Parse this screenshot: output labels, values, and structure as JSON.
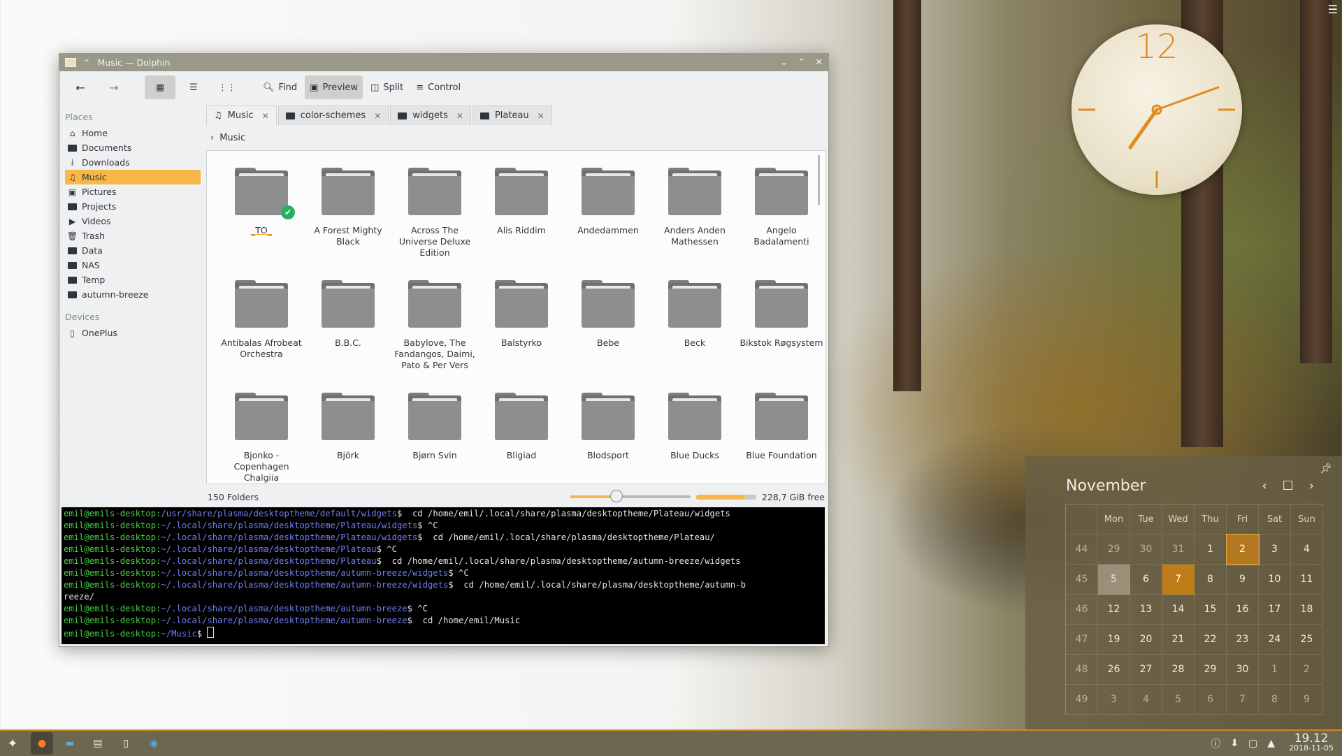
{
  "window": {
    "title": "Music — Dolphin",
    "toolbar": {
      "find": "Find",
      "preview": "Preview",
      "split": "Split",
      "control": "Control"
    },
    "places_heading": "Places",
    "places": [
      {
        "label": "Home",
        "icon": "home-icon"
      },
      {
        "label": "Documents",
        "icon": "documents-icon"
      },
      {
        "label": "Downloads",
        "icon": "download-icon"
      },
      {
        "label": "Music",
        "icon": "music-icon"
      },
      {
        "label": "Pictures",
        "icon": "pictures-icon"
      },
      {
        "label": "Projects",
        "icon": "folder-icon"
      },
      {
        "label": "Videos",
        "icon": "videos-icon"
      },
      {
        "label": "Trash",
        "icon": "trash-icon"
      },
      {
        "label": "Data",
        "icon": "folder-icon"
      },
      {
        "label": "NAS",
        "icon": "folder-icon"
      },
      {
        "label": "Temp",
        "icon": "folder-icon"
      },
      {
        "label": "autumn-breeze",
        "icon": "folder-icon"
      }
    ],
    "devices_heading": "Devices",
    "devices": [
      {
        "label": "OnePlus",
        "icon": "phone-icon"
      }
    ],
    "tabs": [
      {
        "label": "Music",
        "icon": "music-icon"
      },
      {
        "label": "color-schemes",
        "icon": "folder-icon"
      },
      {
        "label": "widgets",
        "icon": "folder-icon"
      },
      {
        "label": "Plateau",
        "icon": "folder-icon"
      }
    ],
    "breadcrumb": "Music",
    "folders": [
      "_TO_",
      "A Forest Mighty Black",
      "Across The Universe Deluxe Edition",
      "Alis Riddim",
      "Andedammen",
      "Anders Anden Mathessen",
      "Angelo Badalamenti",
      "Antibalas Afrobeat Orchestra",
      "B.B.C.",
      "Babylove, The Fandangos, Daimi, Pato & Per Vers",
      "Balstyrko",
      "Bebe",
      "Beck",
      "Bikstok Røgsystem",
      "Bjonko - Copenhagen Chalgiia",
      "Björk",
      "Bjørn Svin",
      "Bligiad",
      "Blodsport",
      "Blue Ducks",
      "Blue Foundation"
    ],
    "status": {
      "count": "150 Folders",
      "free": "228,7 GiB free"
    },
    "terminal": [
      {
        "user": "emil@emils-desktop:",
        "path": "/usr/share/plasma/desktoptheme/default/widgets",
        "cmd": "$  cd /home/emil/.local/share/plasma/desktoptheme/Plateau/widgets"
      },
      {
        "user": "emil@emils-desktop:",
        "path": "~/.local/share/plasma/desktoptheme/Plateau/widgets",
        "cmd": "$ ^C"
      },
      {
        "user": "emil@emils-desktop:",
        "path": "~/.local/share/plasma/desktoptheme/Plateau/widgets",
        "cmd": "$  cd /home/emil/.local/share/plasma/desktoptheme/Plateau/"
      },
      {
        "user": "emil@emils-desktop:",
        "path": "~/.local/share/plasma/desktoptheme/Plateau",
        "cmd": "$ ^C"
      },
      {
        "user": "emil@emils-desktop:",
        "path": "~/.local/share/plasma/desktoptheme/Plateau",
        "cmd": "$  cd /home/emil/.local/share/plasma/desktoptheme/autumn-breeze/widgets"
      },
      {
        "user": "emil@emils-desktop:",
        "path": "~/.local/share/plasma/desktoptheme/autumn-breeze/widgets",
        "cmd": "$ ^C"
      },
      {
        "user": "emil@emils-desktop:",
        "path": "~/.local/share/plasma/desktoptheme/autumn-breeze/widgets",
        "cmd": "$  cd /home/emil/.local/share/plasma/desktoptheme/autumn-b"
      },
      {
        "user": "",
        "path": "",
        "cmd": "reeze/"
      },
      {
        "user": "emil@emils-desktop:",
        "path": "~/.local/share/plasma/desktoptheme/autumn-breeze",
        "cmd": "$ ^C"
      },
      {
        "user": "emil@emils-desktop:",
        "path": "~/.local/share/plasma/desktoptheme/autumn-breeze",
        "cmd": "$  cd /home/emil/Music"
      },
      {
        "user": "emil@emils-desktop:",
        "path": "~/Music",
        "cmd": "$ "
      }
    ]
  },
  "clock": {
    "twelve": "12"
  },
  "calendar": {
    "month": "November",
    "weekdays": [
      "Mon",
      "Tue",
      "Wed",
      "Thu",
      "Fri",
      "Sat",
      "Sun"
    ],
    "weeks": [
      {
        "num": "44",
        "days": [
          "29",
          "30",
          "31",
          "1",
          "2",
          "3",
          "4"
        ]
      },
      {
        "num": "45",
        "days": [
          "5",
          "6",
          "7",
          "8",
          "9",
          "10",
          "11"
        ]
      },
      {
        "num": "46",
        "days": [
          "12",
          "13",
          "14",
          "15",
          "16",
          "17",
          "18"
        ]
      },
      {
        "num": "47",
        "days": [
          "19",
          "20",
          "21",
          "22",
          "23",
          "24",
          "25"
        ]
      },
      {
        "num": "48",
        "days": [
          "26",
          "27",
          "28",
          "29",
          "30",
          "1",
          "2"
        ]
      },
      {
        "num": "49",
        "days": [
          "3",
          "4",
          "5",
          "6",
          "7",
          "8",
          "9"
        ]
      }
    ]
  },
  "panel": {
    "time": "19.12",
    "date": "2018-11-05"
  },
  "colors": {
    "accent": "#f6b848",
    "titlebar": "#9a9888",
    "panel": "#6b6751",
    "today": "#c07c18"
  }
}
